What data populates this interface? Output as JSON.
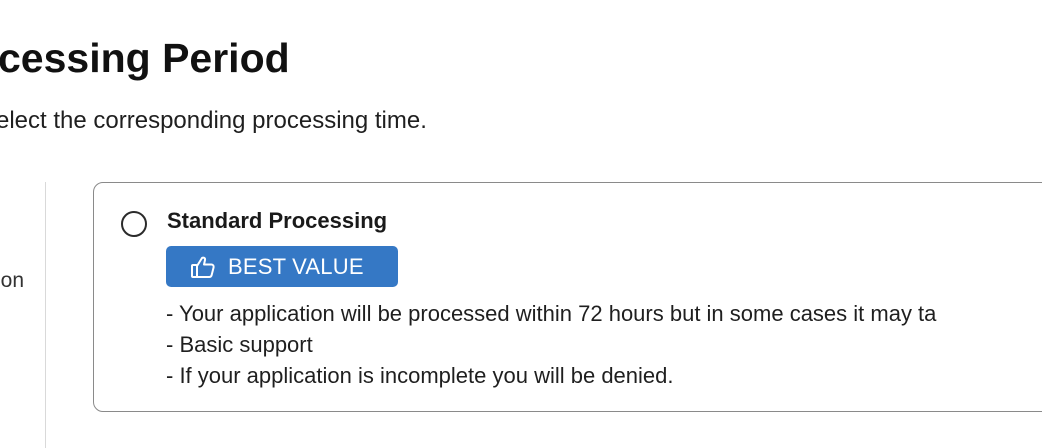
{
  "section": {
    "title": "cessing Period",
    "subtitle": "elect the corresponding processing time.",
    "side_label": "ion"
  },
  "option": {
    "title": "Standard Processing",
    "selected": false,
    "badge": {
      "label": "BEST VALUE",
      "icon": "thumbs-up-icon",
      "color": "#3578c5"
    },
    "features": [
      "- Your application will be processed within 72 hours but in some cases it may ta",
      "- Basic support",
      "- If your application is incomplete you will be denied."
    ]
  }
}
